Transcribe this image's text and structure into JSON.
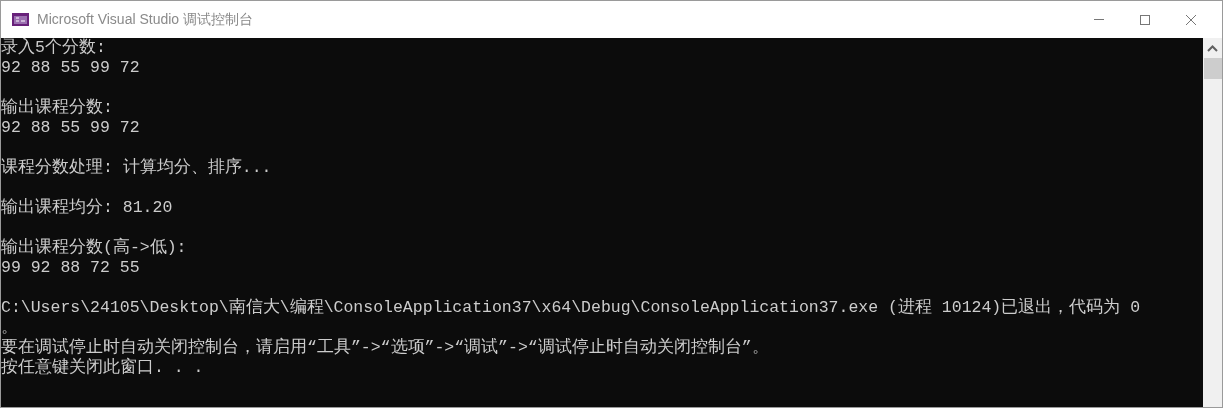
{
  "window": {
    "title": "Microsoft Visual Studio 调试控制台"
  },
  "console": {
    "blocks": [
      [
        "录入5个分数:",
        "92 88 55 99 72"
      ],
      [
        "输出课程分数:",
        "92 88 55 99 72"
      ],
      [
        "课程分数处理: 计算均分、排序..."
      ],
      [
        "输出课程均分: 81.20"
      ],
      [
        "输出课程分数(高->低):",
        "99 92 88 72 55"
      ],
      [
        "C:\\Users\\24105\\Desktop\\南信大\\编程\\ConsoleApplication37\\x64\\Debug\\ConsoleApplication37.exe (进程 10124)已退出，代码为 0",
        "。",
        "要在调试停止时自动关闭控制台，请启用“工具”->“选项”->“调试”->“调试停止时自动关闭控制台”。",
        "按任意键关闭此窗口. . ."
      ]
    ]
  }
}
